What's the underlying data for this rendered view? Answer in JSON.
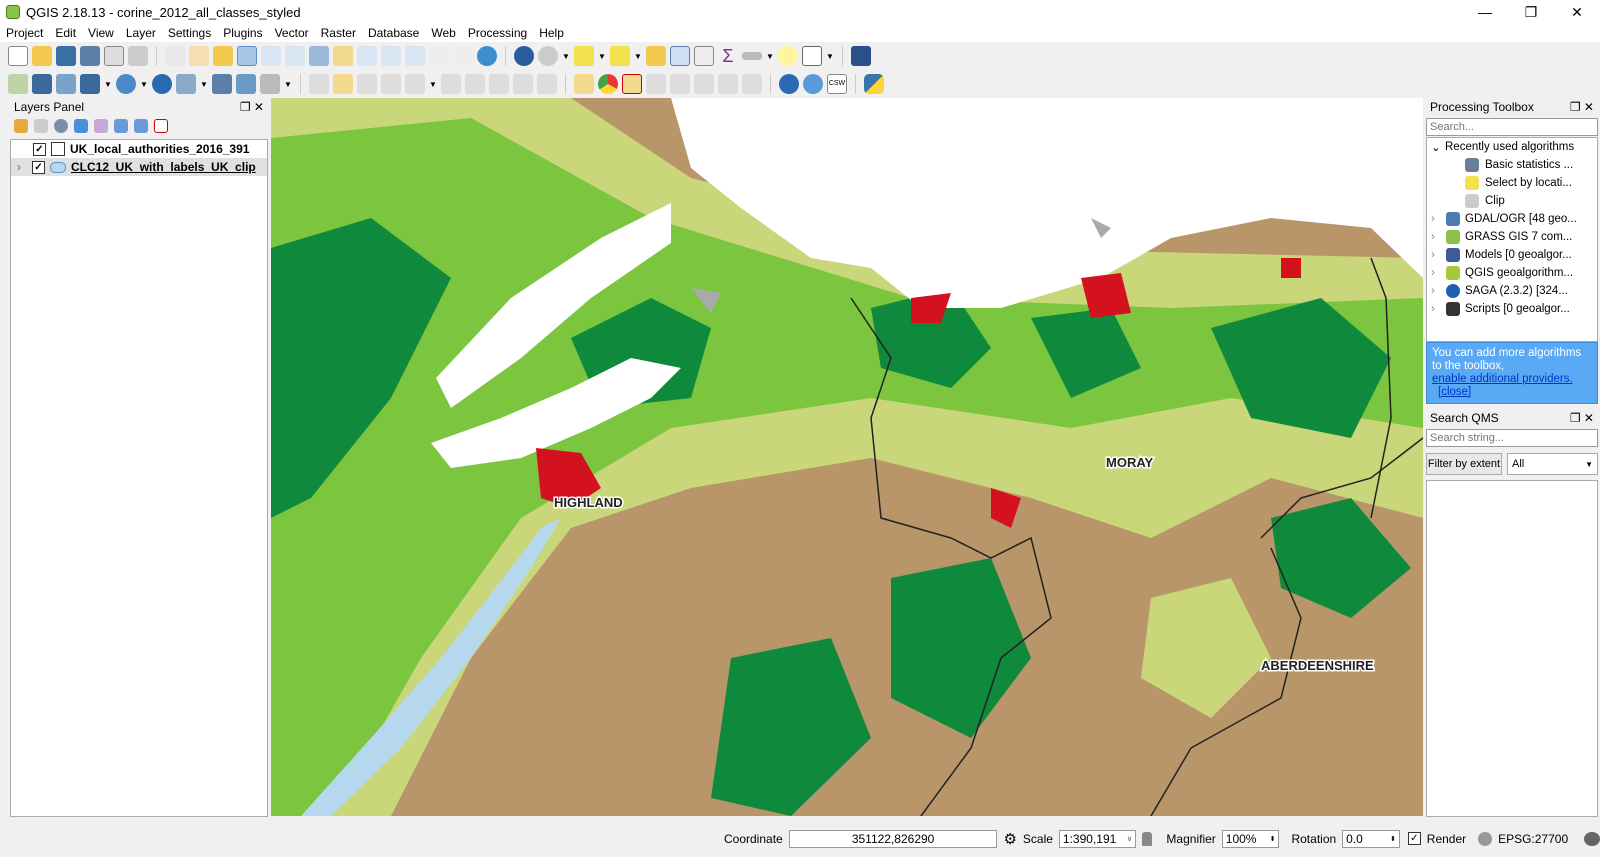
{
  "window": {
    "title": "QGIS 2.18.13 - corine_2012_all_classes_styled",
    "minimize": "—",
    "maximize": "❐",
    "close": "✕"
  },
  "menu": [
    "Project",
    "Edit",
    "View",
    "Layer",
    "Settings",
    "Plugins",
    "Vector",
    "Raster",
    "Database",
    "Web",
    "Processing",
    "Help"
  ],
  "layers_panel": {
    "title": "Layers Panel",
    "layers": [
      {
        "name": "UK_local_authorities_2016_391",
        "checked": true
      },
      {
        "name": "CLC12_UK_with_labels_UK_clip",
        "checked": true
      }
    ]
  },
  "processing": {
    "title": "Processing Toolbox",
    "search_placeholder": "Search...",
    "recent": "Recently used algorithms",
    "recent_items": [
      "Basic statistics ...",
      "Select by locati...",
      "Clip"
    ],
    "providers": [
      "GDAL/OGR [48 geo...",
      "GRASS GIS 7 com...",
      "Models [0 geoalgor...",
      "QGIS geoalgorithm...",
      "SAGA (2.3.2) [324...",
      "Scripts [0 geoalgor..."
    ],
    "info_text": "You can add more algorithms to the toolbox,",
    "info_link": "enable additional providers.",
    "info_close": "[close]"
  },
  "qms": {
    "title": "Search QMS",
    "search_placeholder": "Search string...",
    "filter_button": "Filter by extent",
    "filter_value": "All"
  },
  "map": {
    "labels": [
      "HIGHLAND",
      "MORAY",
      "ABERDEENSHIRE"
    ],
    "colors": {
      "base": "#b8966a",
      "forest": "#0f8a3c",
      "green": "#7cc53f",
      "light": "#d6e08a",
      "water": "#b6d8ee",
      "urban": "#d4111f"
    }
  },
  "status": {
    "coordinate_label": "Coordinate",
    "coordinate": "351122,826290",
    "scale_label": "Scale",
    "scale": "1:390,191",
    "magnifier_label": "Magnifier",
    "magnifier": "100%",
    "rotation_label": "Rotation",
    "rotation": "0.0",
    "render_label": "Render",
    "crs": "EPSG:27700"
  }
}
